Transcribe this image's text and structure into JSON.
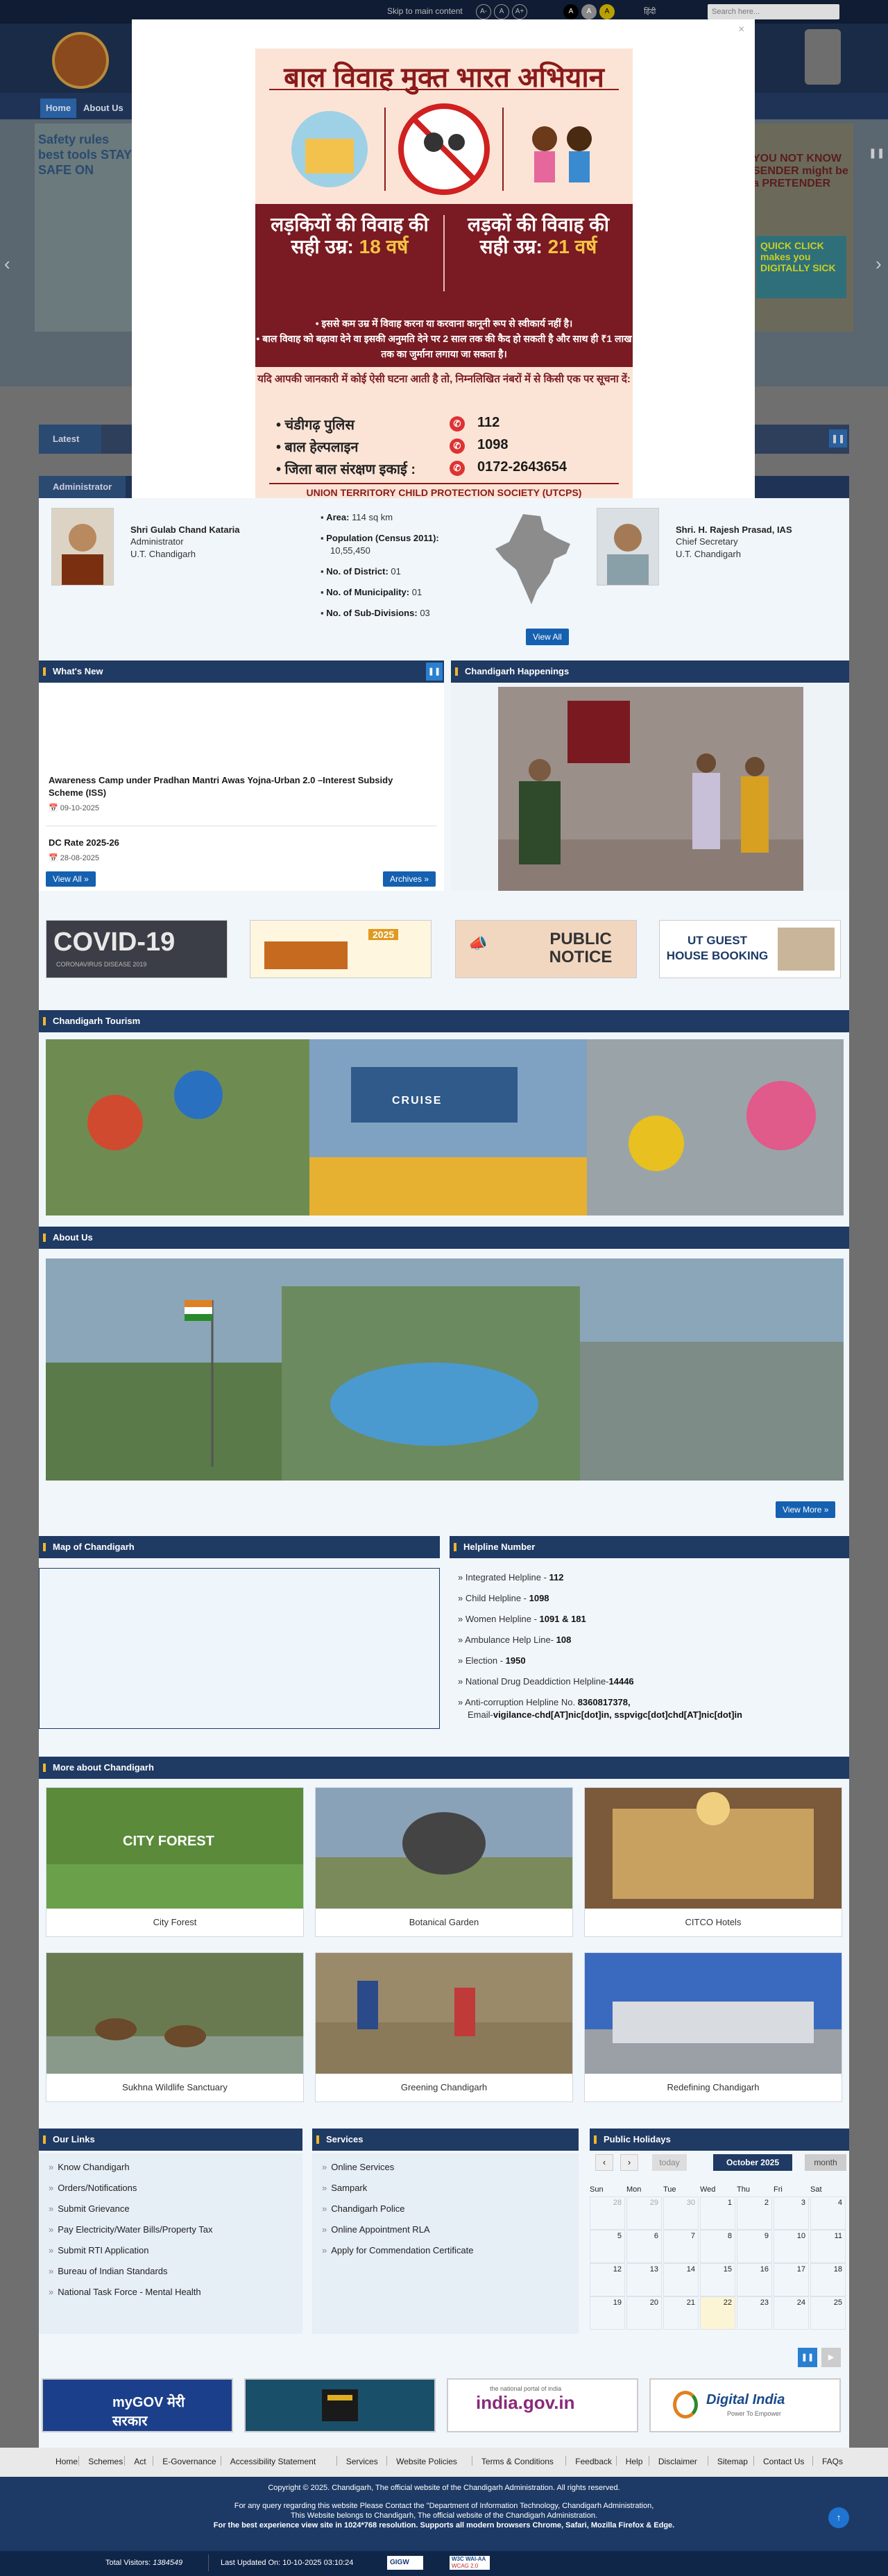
{
  "topbar": {
    "skip": "Skip to main content",
    "font_small": "A-",
    "font_normal": "A",
    "font_large": "A+",
    "contrast_a": "A",
    "contrast_b": "A",
    "contrast_c": "A",
    "lang": "हिंदी",
    "search_placeholder": "Search here..."
  },
  "nav": {
    "home": "Home",
    "about": "About Us"
  },
  "banner": {
    "left_text": "Safety rules best tools STAY SAFE ON",
    "right_text": "YOU NOT KNOW SENDER might be a PRETENDER",
    "right_cta": "QUICK CLICK makes you DIGITALLY SICK",
    "arrow_prev": "‹",
    "arrow_next": "›"
  },
  "latest": {
    "label": "Latest",
    "pause": "❚❚"
  },
  "admin_bar": {
    "label": "Administrator"
  },
  "modal": {
    "close": "×",
    "title": "बाल विवाह मुक्त भारत अभियान",
    "girls": "लड़कियों की विवाह की सही उम्र:",
    "girls_age": "18 वर्ष",
    "boys": "लड़कों की विवाह की सही उम्र:",
    "boys_age": "21 वर्ष",
    "bullet1": "• इससे कम उम्र में विवाह करना या करवाना कानूनी रूप से स्वीकार्य नहीं है।",
    "bullet2": "• बाल विवाह को बढ़ावा देने वा इसकी अनुमति देने पर 2 साल तक की कैद हो सकती है और साथ ही ₹1 लाख तक का जुर्माना लगाया जा सकता है।",
    "info": "यदि आपकी जानकारी में कोई ऐसी घटना आती है तो, निम्नलिखित नंबरों में से किसी एक पर सूचना दें:",
    "rows": [
      {
        "label": "• चंडीगढ़ पुलिस",
        "num": "112"
      },
      {
        "label": "• बाल हेल्पलाइन",
        "num": "1098"
      },
      {
        "label": "• जिला बाल संरक्षण इकाई :",
        "num": "0172-2643654"
      }
    ],
    "footer": "UNION TERRITORY CHILD PROTECTION SOCIETY (UTCPS)"
  },
  "admin": {
    "left_name": "Shri Gulab Chand Kataria",
    "left_role": "Administrator",
    "left_place": "U.T. Chandigarh",
    "right_name": "Shri. H. Rajesh Prasad, IAS",
    "right_role": "Chief Secretary",
    "right_place": "U.T. Chandigarh",
    "stats": [
      {
        "label": "Area:",
        "value": "114 sq km"
      },
      {
        "label": "Population (Census 2011):",
        "value": "10,55,450"
      },
      {
        "label": "No. of District:",
        "value": "01"
      },
      {
        "label": "No. of Municipality:",
        "value": "01"
      },
      {
        "label": "No. of Sub-Divisions:",
        "value": "03"
      }
    ],
    "view_all": "View All"
  },
  "whats_new": {
    "title": "What's New",
    "pause": "❚❚",
    "items": [
      {
        "text": "Awareness Camp under Pradhan Mantri Awas Yojna-Urban 2.0 –Interest Subsidy Scheme (ISS)",
        "date": "09-10-2025"
      },
      {
        "text": "DC Rate 2025-26",
        "date": "28-08-2025"
      }
    ],
    "view_all": "View All",
    "archives": "Archives"
  },
  "happenings": {
    "title": "Chandigarh Happenings"
  },
  "quick_banners": {
    "covid": "COVID-19",
    "covid_sub": "CORONAVIRUS DISEASE 2019",
    "year": "2025",
    "public": "PUBLIC NOTICE",
    "guest": "UT GUEST HOUSE BOOKING"
  },
  "tourism": {
    "title": "Chandigarh Tourism",
    "cruise": "CRUISE"
  },
  "about": {
    "title": "About Us",
    "view_more": "View More"
  },
  "map": {
    "title": "Map of Chandigarh"
  },
  "helpline": {
    "title": "Helpline Number",
    "items": [
      {
        "label": "Integrated Helpline - ",
        "value": "112"
      },
      {
        "label": "Child Helpline - ",
        "value": "1098"
      },
      {
        "label": "Women Helpline - ",
        "value": "1091 & 181"
      },
      {
        "label": "Ambulance Help Line- ",
        "value": "108"
      },
      {
        "label": "Election - ",
        "value": "1950"
      },
      {
        "label": "National Drug Deaddiction Helpline-",
        "value": "14446"
      }
    ],
    "anti_label": "Anti-corruption Helpline No. ",
    "anti_value": "8360817378,",
    "email_label": "Email-",
    "email_value": "vigilance-chd[AT]nic[dot]in, sspvigc[dot]chd[AT]nic[dot]in"
  },
  "more": {
    "title": "More about Chandigarh",
    "cards": [
      "City Forest",
      "Botanical Garden",
      "CITCO Hotels",
      "Sukhna Wildlife Sanctuary",
      "Greening Chandigarh",
      "Redefining Chandigarh"
    ],
    "forest_sign": "CITY FOREST"
  },
  "our_links": {
    "title": "Our Links",
    "items": [
      "Know Chandigarh",
      "Orders/Notifications",
      "Submit Grievance",
      "Pay Electricity/Water Bills/Property Tax",
      "Submit RTI Application",
      "Bureau of Indian Standards",
      "National Task Force - Mental Health"
    ]
  },
  "services": {
    "title": "Services",
    "items": [
      "Online Services",
      "Sampark",
      "Chandigarh Police",
      "Online Appointment RLA",
      "Apply for Commendation Certificate"
    ]
  },
  "holidays": {
    "title": "Public Holidays",
    "prev": "‹",
    "next": "›",
    "today": "today",
    "month_label": "October 2025",
    "view": "month",
    "days": [
      "Sun",
      "Mon",
      "Tue",
      "Wed",
      "Thu",
      "Fri",
      "Sat"
    ],
    "weeks": [
      [
        "28",
        "29",
        "30",
        "1",
        "2",
        "3",
        "4"
      ],
      [
        "5",
        "6",
        "7",
        "8",
        "9",
        "10",
        "11"
      ],
      [
        "12",
        "13",
        "14",
        "15",
        "16",
        "17",
        "18"
      ],
      [
        "19",
        "20",
        "21",
        "22",
        "23",
        "24",
        "25"
      ]
    ]
  },
  "carousel": {
    "pause": "❚❚",
    "play": "▶"
  },
  "partners": {
    "mygov": "myGOV मेरी सरकार",
    "india": "india.gov.in",
    "india_sub": "the national portal of india",
    "digital": "Digital India",
    "digital_sub": "Power To Empower"
  },
  "footer_nav": [
    "Home",
    "Schemes",
    "Act",
    "E-Governance",
    "Accessibility Statement",
    "Services",
    "Website Policies",
    "Terms & Conditions",
    "Feedback",
    "Help",
    "Disclaimer",
    "Sitemap",
    "Contact Us",
    "FAQs"
  ],
  "footer": {
    "copyright": "Copyright © 2025. Chandigarh, The official website of the Chandigarh Administration. All rights reserved.",
    "line2": "For any query regarding this website Please Contact the \"Department of Information Technology, Chandigarh Administration,",
    "line3": "This Website belongs to Chandigarh, The official website of the Chandigarh Administration.",
    "line4": "For the  best experience view site in 1024*768 resolution.  Supports all modern browsers Chrome, Safari, Mozilla Firefox & Edge.",
    "visitors_label": "Total Visitors:",
    "visitors": "1384549",
    "updated": "Last Updated On: 10-10-2025 03:10:24",
    "gigw": "GIGW",
    "w3c": "W3C WAI-AA",
    "w3c_sub": "WCAG 2.0"
  }
}
